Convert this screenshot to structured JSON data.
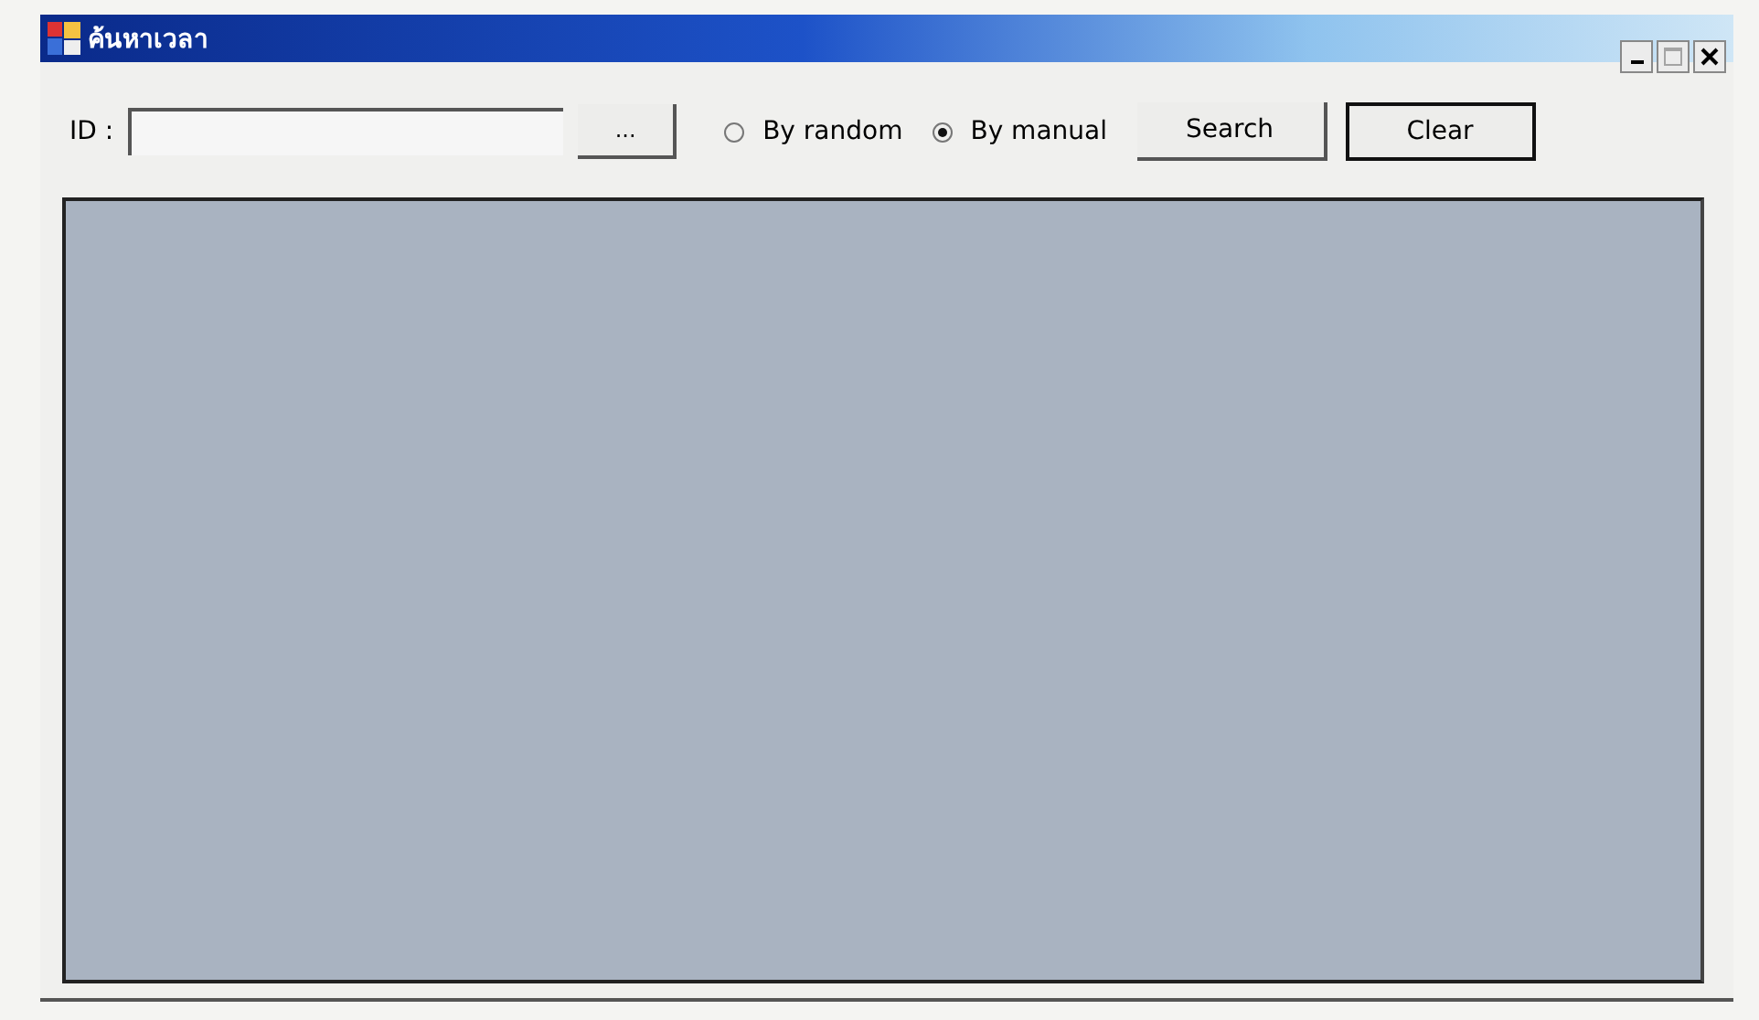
{
  "window": {
    "title": "ค้นหาเวลา",
    "controls": [
      {
        "kind": "minimize",
        "disabled": false
      },
      {
        "kind": "maximize",
        "disabled": true
      },
      {
        "kind": "close",
        "disabled": false
      }
    ]
  },
  "id_field": {
    "label": "ID :"
  },
  "browse_button": {
    "label": "..."
  },
  "mode_options": [
    {
      "label": "By random",
      "selected": false
    },
    {
      "label": "By manual",
      "selected": true
    }
  ],
  "buttons": [
    {
      "label": "Search",
      "focused": false
    },
    {
      "label": "Clear",
      "focused": true
    }
  ]
}
